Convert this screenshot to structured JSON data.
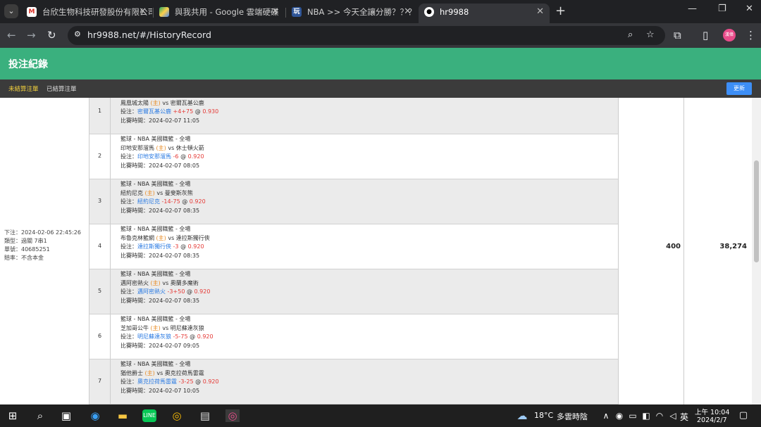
{
  "browser": {
    "tabs": [
      {
        "title": "台欣生物科技研發股份有限公司",
        "favicon": "gmail-icon"
      },
      {
        "title": "與我共用 - Google 雲端硬碟",
        "favicon": "drive-icon"
      },
      {
        "title": "NBA >> 今天全讓分勝？？？",
        "favicon": "site-icon",
        "favicon_text": "玩"
      },
      {
        "title": "hr9988",
        "favicon": "soccer-icon"
      }
    ],
    "url": "hr9988.net/#/HistoryRecord",
    "avatar_text": "漢偉"
  },
  "page": {
    "title": "投注紀錄",
    "tab_unsettled": "未結算注單",
    "tab_settled": "已結算注單",
    "refresh_label": "更新"
  },
  "ticket": {
    "placed": "下注：2024-02-06 22:45:26",
    "type": "類型：過關 7串1",
    "ticket_no": "單號：40685251",
    "odds_note": "賠率：不含本金",
    "stake": "400",
    "payout": "38,274"
  },
  "bets": [
    {
      "num": "1",
      "league": "籃球 - NBA 美國職籃 - 全場",
      "home": "鳳凰城太陽",
      "home_tag": "(主)",
      "vs": "vs",
      "away": "密爾瓦基公鹿",
      "bet_prefix": "投注：",
      "pick": "密爾瓦基公鹿",
      "line": "+4+75",
      "at": "@",
      "odds": "0.930",
      "time": "比賽時間：2024-02-07 11:05"
    },
    {
      "num": "2",
      "league": "籃球 - NBA 美國職籃 - 全場",
      "home": "印地安那溜馬",
      "home_tag": "(主)",
      "vs": "vs",
      "away": "休士頓火箭",
      "bet_prefix": "投注：",
      "pick": "印地安那溜馬",
      "line": "-6",
      "at": "@",
      "odds": "0.920",
      "time": "比賽時間：2024-02-07 08:05"
    },
    {
      "num": "3",
      "league": "籃球 - NBA 美國職籃 - 全場",
      "home": "紐約尼克",
      "home_tag": "(主)",
      "vs": "vs",
      "away": "曼斐斯灰熊",
      "bet_prefix": "投注：",
      "pick": "紐約尼克",
      "line": "-14-75",
      "at": "@",
      "odds": "0.920",
      "time": "比賽時間：2024-02-07 08:35"
    },
    {
      "num": "4",
      "league": "籃球 - NBA 美國職籃 - 全場",
      "home": "布魯克林籃網",
      "home_tag": "(主)",
      "vs": "vs",
      "away": "達拉斯獨行俠",
      "bet_prefix": "投注：",
      "pick": "達拉斯獨行俠",
      "line": "-3",
      "at": "@",
      "odds": "0.920",
      "time": "比賽時間：2024-02-07 08:35"
    },
    {
      "num": "5",
      "league": "籃球 - NBA 美國職籃 - 全場",
      "home": "邁阿密熱火",
      "home_tag": "(主)",
      "vs": "vs",
      "away": "奧蘭多魔術",
      "bet_prefix": "投注：",
      "pick": "邁阿密熱火",
      "line": "-3+50",
      "at": "@",
      "odds": "0.920",
      "time": "比賽時間：2024-02-07 08:35"
    },
    {
      "num": "6",
      "league": "籃球 - NBA 美國職籃 - 全場",
      "home": "芝加哥公牛",
      "home_tag": "(主)",
      "vs": "vs",
      "away": "明尼蘇達灰狼",
      "bet_prefix": "投注：",
      "pick": "明尼蘇達灰狼",
      "line": "-5-75",
      "at": "@",
      "odds": "0.920",
      "time": "比賽時間：2024-02-07 09:05"
    },
    {
      "num": "7",
      "league": "籃球 - NBA 美國職籃 - 全場",
      "home": "猶他爵士",
      "home_tag": "(主)",
      "vs": "vs",
      "away": "奧克拉荷馬雷霆",
      "bet_prefix": "投注：",
      "pick": "奧克拉荷馬雷霆",
      "line": "-3-25",
      "at": "@",
      "odds": "0.920",
      "time": "比賽時間：2024-02-07 10:05"
    }
  ],
  "taskbar": {
    "weather_temp": "18°C",
    "weather_desc": "多雲時陰",
    "ime": "英",
    "time": "上午 10:04",
    "date": "2024/2/7"
  }
}
